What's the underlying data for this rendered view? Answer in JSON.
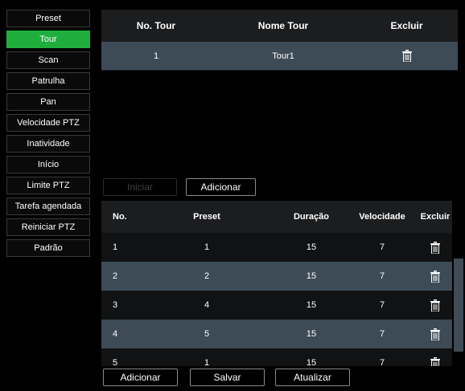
{
  "sidebar": {
    "items": [
      {
        "label": "Preset",
        "active": false
      },
      {
        "label": "Tour",
        "active": true
      },
      {
        "label": "Scan",
        "active": false
      },
      {
        "label": "Patrulha",
        "active": false
      },
      {
        "label": "Pan",
        "active": false
      },
      {
        "label": "Velocidade PTZ",
        "active": false
      },
      {
        "label": "Inatividade",
        "active": false
      },
      {
        "label": "Início",
        "active": false
      },
      {
        "label": "Limite PTZ",
        "active": false
      },
      {
        "label": "Tarefa agendada",
        "active": false
      },
      {
        "label": "Reiniciar PTZ",
        "active": false
      },
      {
        "label": "Padrão",
        "active": false
      }
    ]
  },
  "tour_table": {
    "headers": {
      "no": "No. Tour",
      "name": "Nome Tour",
      "delete": "Excluir"
    },
    "rows": [
      {
        "no": "1",
        "name": "Tour1"
      }
    ]
  },
  "tour_actions": {
    "start": "Iniciar",
    "add": "Adicionar"
  },
  "preset_table": {
    "headers": {
      "no": "No.",
      "preset": "Preset",
      "duration": "Duração",
      "speed": "Velocidade",
      "delete": "Excluir"
    },
    "rows": [
      {
        "no": "1",
        "preset": "1",
        "duration": "15",
        "speed": "7"
      },
      {
        "no": "2",
        "preset": "2",
        "duration": "15",
        "speed": "7"
      },
      {
        "no": "3",
        "preset": "4",
        "duration": "15",
        "speed": "7"
      },
      {
        "no": "4",
        "preset": "5",
        "duration": "15",
        "speed": "7"
      },
      {
        "no": "5",
        "preset": "1",
        "duration": "15",
        "speed": "7"
      }
    ]
  },
  "bottom_actions": {
    "add": "Adicionar",
    "save": "Salvar",
    "refresh": "Atualizar"
  },
  "colors": {
    "accent": "#1fae3c",
    "row_highlight": "#3d4b56",
    "header_bg": "#1c1d1f"
  },
  "icons": {
    "delete": "trash-icon"
  }
}
